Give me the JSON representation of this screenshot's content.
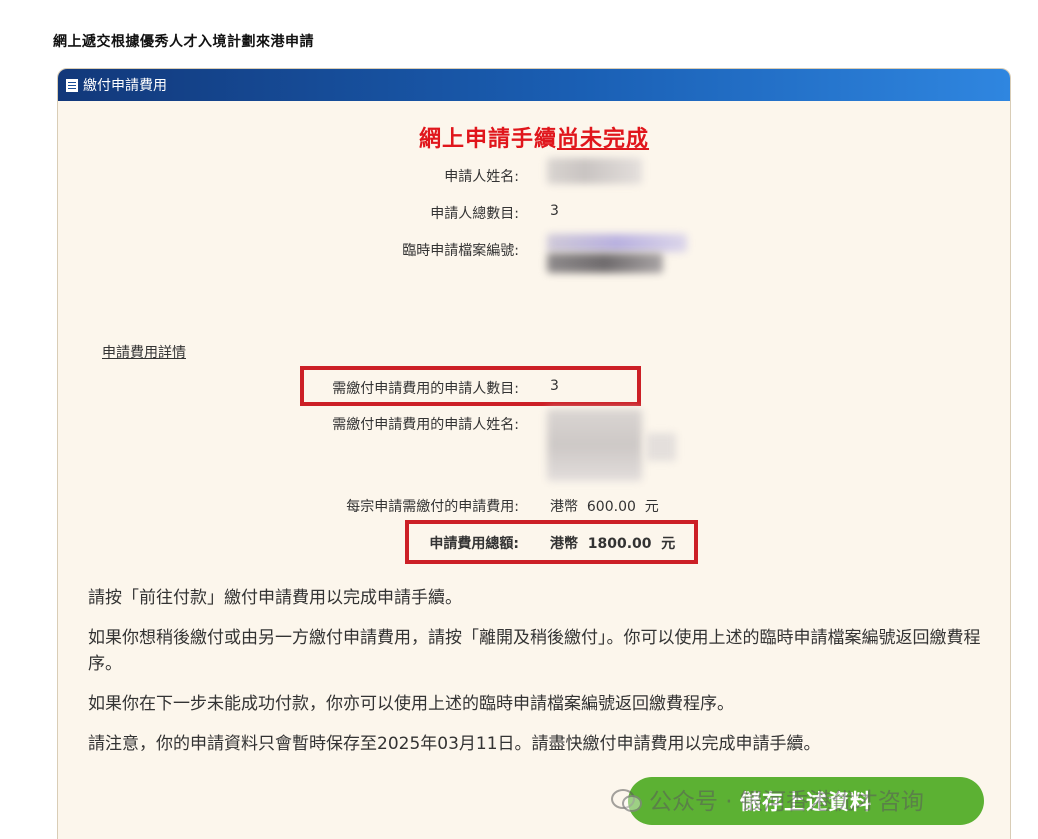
{
  "page_title": "網上遞交根據優秀人才入境計劃來港申請",
  "panel": {
    "header": "繳付申請費用",
    "status_prefix": "網上申請手續",
    "status_emphasis": "尚未完成"
  },
  "applicant": {
    "name_label": "申請人姓名:",
    "count_label": "申請人總數目:",
    "count_value": "3",
    "file_label": "臨時申請檔案編號:"
  },
  "fees": {
    "link": "申請費用詳情",
    "payers_count_label": "需繳付申請費用的申請人數目:",
    "payers_count_value": "3",
    "payers_name_label": "需繳付申請費用的申請人姓名:",
    "per_app_label": "每宗申請需繳付的申請費用:",
    "per_app_value": "港幣  600.00  元",
    "total_label": "申請費用總額:",
    "total_value": "港幣  1800.00  元"
  },
  "instructions": [
    "請按「前往付款」繳付申請費用以完成申請手續。",
    "如果你想稍後繳付或由另一方繳付申請費用，請按「離開及稍後繳付」。你可以使用上述的臨時申請檔案編號返回繳費程序。",
    "如果你在下一步未能成功付款，你亦可以使用上述的臨時申請檔案編號返回繳費程序。",
    "請注意，你的申請資料只會暫時保存至2025年03月11日。請盡快繳付申請費用以完成申請手續。"
  ],
  "save_button": "儲存上述資料",
  "watermark": "公众号 · 银河香港优才咨询",
  "colors": {
    "header_start": "#12387a",
    "header_end": "#2f86e0",
    "status_red": "#e0161c",
    "highlight_box": "#cc1f26",
    "button_green": "#5cb133",
    "panel_bg": "#fcf6ec"
  },
  "icons": {
    "panel_header": "document-list-icon",
    "watermark": "wechat-icon"
  }
}
